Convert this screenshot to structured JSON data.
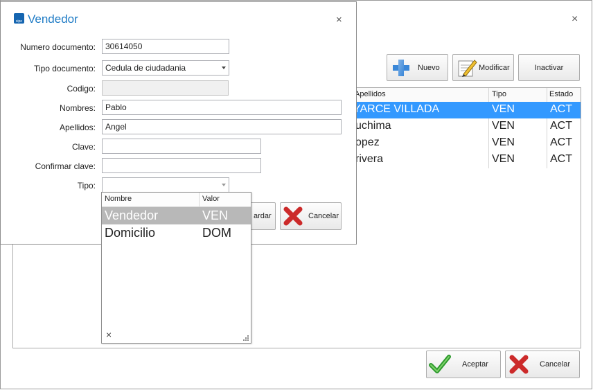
{
  "background": {
    "toolbar": {
      "nuevo": "Nuevo",
      "modificar": "Modificar",
      "inactivar": "Inactivar"
    },
    "columns": [
      "Apellidos",
      "Tipo",
      "Estado"
    ],
    "rows": [
      {
        "apellidos": "YARCE VILLADA",
        "tipo": "VEN",
        "estado": "ACT"
      },
      {
        "apellidos": "uchima",
        "tipo": "VEN",
        "estado": "ACT"
      },
      {
        "apellidos": "opez",
        "tipo": "VEN",
        "estado": "ACT"
      },
      {
        "apellidos": "rivera",
        "tipo": "VEN",
        "estado": "ACT"
      }
    ],
    "aceptar": "Aceptar",
    "cancelar": "Cancelar",
    "close": "×"
  },
  "dialog": {
    "title": "Vendedor",
    "icon_text": "sipo",
    "close": "×",
    "labels": {
      "numero": "Numero documento:",
      "tipo_doc": "Tipo documento:",
      "codigo": "Codigo:",
      "nombres": "Nombres:",
      "apellidos": "Apellidos:",
      "clave": "Clave:",
      "confirmar": "Confirmar clave:",
      "tipo": "Tipo:"
    },
    "values": {
      "numero": "30614050",
      "tipo_doc": "Cedula de ciudadania",
      "codigo": "",
      "nombres": "Pablo",
      "apellidos": "Angel",
      "clave": "",
      "confirmar": "",
      "tipo": ""
    },
    "guardar_partial": "ardar",
    "cancelar": "Cancelar"
  },
  "popup": {
    "columns": [
      "Nombre",
      "Valor"
    ],
    "rows": [
      {
        "nombre": "Vendedor",
        "valor": "VEN"
      },
      {
        "nombre": "Domicilio",
        "valor": "DOM"
      }
    ],
    "close": "×"
  },
  "colors": {
    "accent": "#3399ff",
    "title": "#1e7bc5",
    "popup_selected": "#b8b8b8"
  }
}
